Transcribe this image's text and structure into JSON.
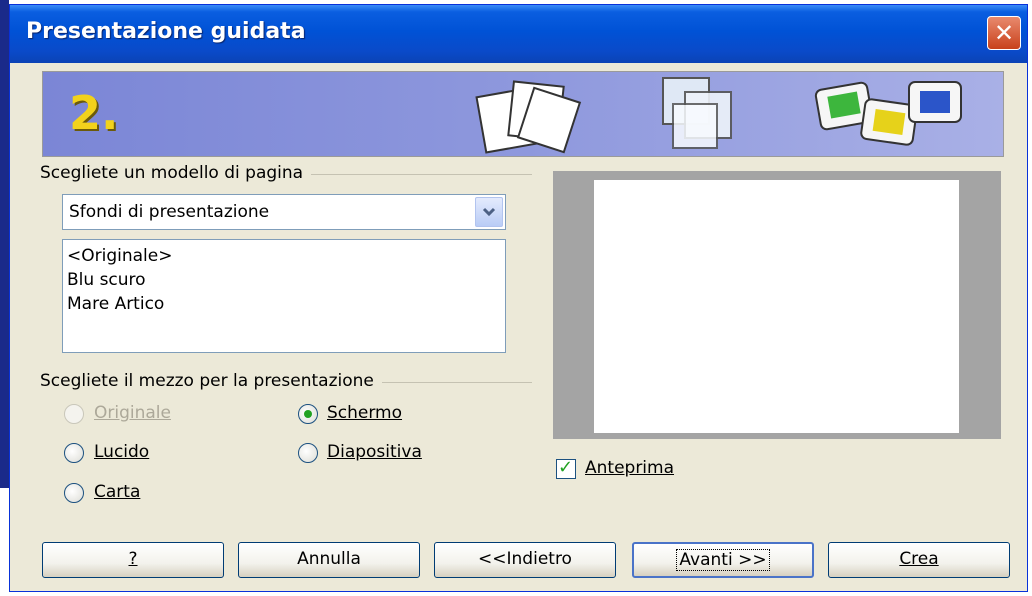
{
  "window": {
    "title": "Presentazione guidata",
    "close_label": "✕"
  },
  "banner": {
    "step": "2."
  },
  "template_section": {
    "label": "Scegliete un modello di pagina",
    "category_value": "Sfondi di presentazione",
    "templates": [
      "<Originale>",
      "Blu scuro",
      "Mare Artico"
    ]
  },
  "medium_section": {
    "label": "Scegliete il mezzo per la presentazione",
    "options": {
      "originale": "Originale",
      "lucido": "Lucido",
      "carta": "Carta",
      "schermo": "Schermo",
      "diapositiva": "Diapositiva"
    },
    "selected": "schermo",
    "disabled": [
      "originale"
    ]
  },
  "preview": {
    "checkbox_label": "Anteprima",
    "checked": true
  },
  "buttons": {
    "help": "?",
    "cancel": "Annulla",
    "back": "<<Indietro",
    "next": "Avanti >>",
    "create": "Crea"
  },
  "colors": {
    "titlebar": "#0052d6",
    "banner": "#8e98dd",
    "step_number": "#f2d21c",
    "radio_dot": "#21a121"
  },
  "icons": [
    "close-icon",
    "chevron-down-icon",
    "pages-icon",
    "layered-pages-icon",
    "slides-icon"
  ]
}
